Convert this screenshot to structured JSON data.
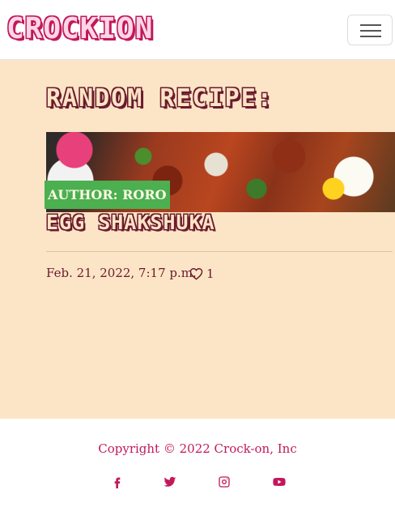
{
  "navbar": {
    "brand": "CROCKION",
    "menu_icon": "hamburger-menu-icon"
  },
  "main": {
    "heading": "RANDOM RECIPE:",
    "recipe": {
      "author_label": "AUTHOR: RORO",
      "title": "EGG SHAKSHUKA",
      "date": "Feb. 21, 2022, 7:17 p.m.",
      "like_icon": "heart-outline-icon",
      "like_count": "1"
    }
  },
  "footer": {
    "copyright": "Copyright © 2022 Crock-on, Inc",
    "social_icons": [
      "facebook-icon",
      "twitter-icon",
      "instagram-icon",
      "youtube-icon"
    ]
  },
  "colors": {
    "page_background": "#fce5c6",
    "brand_pink": "#c2185b",
    "heading_outline": "#6b1a2e",
    "author_badge": "#4caf50"
  }
}
